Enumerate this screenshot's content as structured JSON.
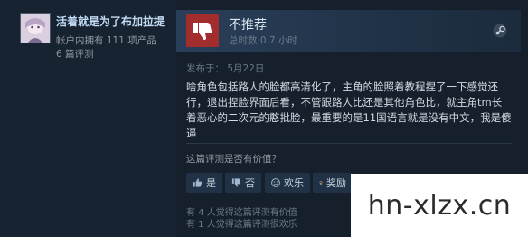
{
  "user": {
    "name": "活着就是为了布加拉提",
    "products": "帐户内拥有 111 项产品",
    "reviews": "6 篇评测"
  },
  "review": {
    "verdict": "不推荐",
    "hours": "总时数 0.7 小时",
    "posted": "发布于：    5月22日",
    "body": "啥角色包括路人的脸都高清化了，主角的脸照着教程捏了一下感觉还行，退出捏脸界面后看，不管跟路人比还是其他角色比，就主角tm长着恶心的二次元的憨批脸，最重要的是11国语言就是没有中文，我是傻逼"
  },
  "helpful": {
    "question": "这篇评测是否有价值？",
    "yes": "是",
    "no": "否",
    "funny": "欢乐",
    "award": "奖励",
    "stat_helpful": "有 4 人觉得这篇评测有价值",
    "stat_funny": "有 1 人觉得这篇评测很欢乐"
  },
  "watermark": "hn-xlzx.cn",
  "colors": {
    "background": "#1b2838",
    "not_recommended": "#a32d2d",
    "username": "#c1dbf4"
  },
  "icons": [
    "avatar",
    "thumbs-down-icon",
    "steam-icon",
    "thumbs-up-icon",
    "thumbs-down-small-icon",
    "smile-icon",
    "award-icon"
  ]
}
